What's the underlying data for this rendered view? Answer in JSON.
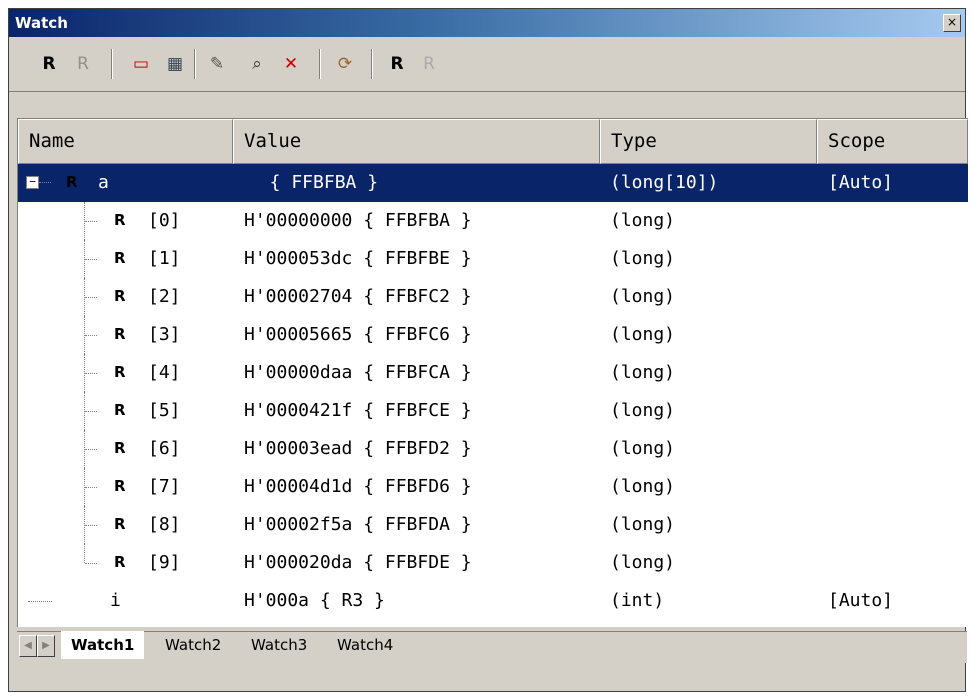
{
  "window": {
    "title": "Watch",
    "close_glyph": "×"
  },
  "toolbar": {
    "buttons": [
      {
        "name": "register-icon",
        "glyph": "R"
      },
      {
        "name": "register-disabled-icon",
        "glyph": "R"
      },
      {
        "name": "record-icon",
        "glyph": "▭"
      },
      {
        "name": "edit-window-icon",
        "glyph": "▦"
      },
      {
        "name": "pencil-icon",
        "glyph": "✎"
      },
      {
        "name": "find-icon",
        "glyph": "⌕"
      },
      {
        "name": "delete-icon",
        "glyph": "✕"
      },
      {
        "name": "refresh-icon",
        "glyph": "⟳"
      },
      {
        "name": "breakpoint-icon",
        "glyph": "R"
      },
      {
        "name": "breakpoint-disabled-icon",
        "glyph": "R"
      }
    ]
  },
  "columns": [
    "Name",
    "Value",
    "Type",
    "Scope"
  ],
  "rows": [
    {
      "name": "a",
      "value": "  { FFBFBA }",
      "type": "(long[10])",
      "scope": "[Auto]",
      "selected": true
    },
    {
      "name": "[0]",
      "value": "H'00000000 { FFBFBA }",
      "type": "(long)",
      "scope": ""
    },
    {
      "name": "[1]",
      "value": "H'000053dc { FFBFBE }",
      "type": "(long)",
      "scope": ""
    },
    {
      "name": "[2]",
      "value": "H'00002704 { FFBFC2 }",
      "type": "(long)",
      "scope": ""
    },
    {
      "name": "[3]",
      "value": "H'00005665 { FFBFC6 }",
      "type": "(long)",
      "scope": ""
    },
    {
      "name": "[4]",
      "value": "H'00000daa { FFBFCA }",
      "type": "(long)",
      "scope": ""
    },
    {
      "name": "[5]",
      "value": "H'0000421f { FFBFCE }",
      "type": "(long)",
      "scope": ""
    },
    {
      "name": "[6]",
      "value": "H'00003ead { FFBFD2 }",
      "type": "(long)",
      "scope": ""
    },
    {
      "name": "[7]",
      "value": "H'00004d1d { FFBFD6 }",
      "type": "(long)",
      "scope": ""
    },
    {
      "name": "[8]",
      "value": "H'00002f5a { FFBFDA }",
      "type": "(long)",
      "scope": ""
    },
    {
      "name": "[9]",
      "value": "H'000020da { FFBFDE }",
      "type": "(long)",
      "scope": ""
    },
    {
      "name": "i",
      "value": "H'000a { R3 }",
      "type": "(int)",
      "scope": "[Auto]"
    }
  ],
  "tabs": [
    "Watch1",
    "Watch2",
    "Watch3",
    "Watch4"
  ],
  "register_glyph": "R",
  "expander_glyph": "−"
}
